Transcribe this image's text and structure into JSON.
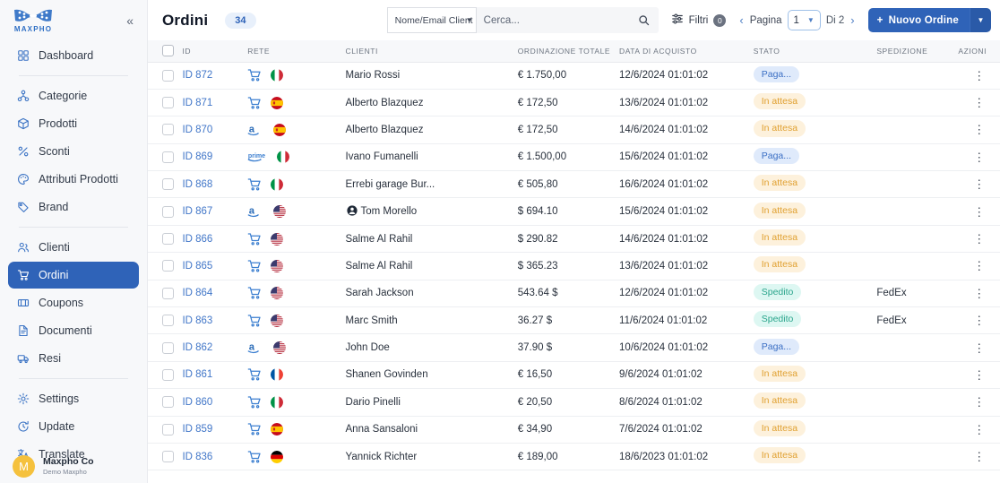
{
  "sidebar": {
    "logo_text": "MAXPHO",
    "collapse_icon": "chevron-double-left-icon",
    "groups": [
      {
        "items": [
          {
            "label": "Dashboard",
            "icon": "dashboard-icon",
            "active": false
          }
        ]
      },
      {
        "items": [
          {
            "label": "Categorie",
            "icon": "categories-icon",
            "active": false
          },
          {
            "label": "Prodotti",
            "icon": "box-icon",
            "active": false
          },
          {
            "label": "Sconti",
            "icon": "percent-icon",
            "active": false
          },
          {
            "label": "Attributi Prodotti",
            "icon": "palette-icon",
            "active": false
          },
          {
            "label": "Brand",
            "icon": "tag-icon",
            "active": false
          }
        ]
      },
      {
        "items": [
          {
            "label": "Clienti",
            "icon": "users-icon",
            "active": false
          },
          {
            "label": "Ordini",
            "icon": "cart-icon",
            "active": true
          },
          {
            "label": "Coupons",
            "icon": "ticket-icon",
            "active": false
          },
          {
            "label": "Documenti",
            "icon": "document-icon",
            "active": false
          },
          {
            "label": "Resi",
            "icon": "truck-icon",
            "active": false
          }
        ]
      },
      {
        "items": [
          {
            "label": "Settings",
            "icon": "gear-icon",
            "active": false
          },
          {
            "label": "Update",
            "icon": "refresh-clock-icon",
            "active": false
          },
          {
            "label": "Translate",
            "icon": "translate-icon",
            "active": false
          }
        ]
      }
    ],
    "account": {
      "initial": "M",
      "name": "Maxpho Co",
      "subtitle": "Demo Maxpho"
    }
  },
  "header": {
    "title": "Ordini",
    "count": "34",
    "search": {
      "field_selector": "Nome/Email Client",
      "placeholder": "Cerca...",
      "value": "",
      "search_icon": "search-icon",
      "caret_icon": "caret-down-icon"
    },
    "filters": {
      "label": "Filtri",
      "count": "0",
      "icon": "filter-sliders-icon"
    },
    "pagination": {
      "prev_icon": "chevron-left-icon",
      "label": "Pagina",
      "current": "1",
      "caret_icon": "caret-down-icon",
      "of_label": "Di 2",
      "next_icon": "chevron-right-icon"
    },
    "new_order": {
      "label": "Nuovo Ordine",
      "plus_icon": "plus-icon",
      "caret_icon": "caret-down-icon"
    },
    "accent_color": "#2f63b8"
  },
  "table": {
    "columns": [
      "ID",
      "RETE",
      "CLIENTI",
      "ORDINAZIONE TOTALE",
      "DATA DI ACQUISTO",
      "STATO",
      "SPEDIZIONE",
      "AZIONI"
    ],
    "rows": [
      {
        "id": "ID 872",
        "network": "cart-icon",
        "flag": "it",
        "client": "Mario Rossi",
        "client_icon": "",
        "total": "€ 1.750,00",
        "date": "12/6/2024 01:01:02",
        "status": "Paga...",
        "status_kind": "paid",
        "shipping": ""
      },
      {
        "id": "ID 871",
        "network": "cart-icon",
        "flag": "es",
        "client": "Alberto Blazquez",
        "client_icon": "",
        "total": "€ 172,50",
        "date": "13/6/2024 01:01:02",
        "status": "In attesa",
        "status_kind": "pending",
        "shipping": ""
      },
      {
        "id": "ID 870",
        "network": "amazon-icon",
        "flag": "es",
        "client": "Alberto Blazquez",
        "client_icon": "",
        "total": "€ 172,50",
        "date": "14/6/2024 01:01:02",
        "status": "In attesa",
        "status_kind": "pending",
        "shipping": ""
      },
      {
        "id": "ID 869",
        "network": "prime-icon",
        "flag": "it",
        "client": "Ivano Fumanelli",
        "client_icon": "",
        "total": "€ 1.500,00",
        "date": "15/6/2024 01:01:02",
        "status": "Paga...",
        "status_kind": "paid",
        "shipping": ""
      },
      {
        "id": "ID 868",
        "network": "cart-icon",
        "flag": "it",
        "client": "Errebi garage Bur...",
        "client_icon": "",
        "total": "€ 505,80",
        "date": "16/6/2024 01:01:02",
        "status": "In attesa",
        "status_kind": "pending",
        "shipping": ""
      },
      {
        "id": "ID 867",
        "network": "amazon-icon",
        "flag": "us",
        "client": "Tom Morello",
        "client_icon": "person-icon",
        "total": "$ 694.10",
        "date": "15/6/2024 01:01:02",
        "status": "In attesa",
        "status_kind": "pending",
        "shipping": ""
      },
      {
        "id": "ID 866",
        "network": "cart-icon",
        "flag": "us",
        "client": "Salme Al Rahil",
        "client_icon": "",
        "total": "$ 290.82",
        "date": "14/6/2024 01:01:02",
        "status": "In attesa",
        "status_kind": "pending",
        "shipping": ""
      },
      {
        "id": "ID 865",
        "network": "cart-icon",
        "flag": "us",
        "client": "Salme Al Rahil",
        "client_icon": "",
        "total": "$ 365.23",
        "date": "13/6/2024 01:01:02",
        "status": "In attesa",
        "status_kind": "pending",
        "shipping": ""
      },
      {
        "id": "ID 864",
        "network": "cart-icon",
        "flag": "us",
        "client": "Sarah Jackson",
        "client_icon": "",
        "total": "543.64 $",
        "date": "12/6/2024 01:01:02",
        "status": "Spedito",
        "status_kind": "shipped",
        "shipping": "FedEx"
      },
      {
        "id": "ID 863",
        "network": "cart-icon",
        "flag": "us",
        "client": "Marc Smith",
        "client_icon": "",
        "total": "36.27 $",
        "date": "11/6/2024 01:01:02",
        "status": "Spedito",
        "status_kind": "shipped",
        "shipping": "FedEx"
      },
      {
        "id": "ID 862",
        "network": "amazon-icon",
        "flag": "us",
        "client": "John Doe",
        "client_icon": "",
        "total": "37.90 $",
        "date": "10/6/2024 01:01:02",
        "status": "Paga...",
        "status_kind": "paid",
        "shipping": ""
      },
      {
        "id": "ID 861",
        "network": "cart-icon",
        "flag": "fr",
        "client": "Shanen Govinden",
        "client_icon": "",
        "total": "€ 16,50",
        "date": "9/6/2024 01:01:02",
        "status": "In attesa",
        "status_kind": "pending",
        "shipping": ""
      },
      {
        "id": "ID 860",
        "network": "cart-icon",
        "flag": "it",
        "client": "Dario Pinelli",
        "client_icon": "",
        "total": "€ 20,50",
        "date": "8/6/2024 01:01:02",
        "status": "In attesa",
        "status_kind": "pending",
        "shipping": ""
      },
      {
        "id": "ID 859",
        "network": "cart-icon",
        "flag": "es",
        "client": "Anna Sansaloni",
        "client_icon": "",
        "total": "€ 34,90",
        "date": "7/6/2024 01:01:02",
        "status": "In attesa",
        "status_kind": "pending",
        "shipping": ""
      },
      {
        "id": "ID 836",
        "network": "cart-icon",
        "flag": "de",
        "client": "Yannick Richter",
        "client_icon": "",
        "total": "€ 189,00",
        "date": "18/6/2023 01:01:02",
        "status": "In attesa",
        "status_kind": "pending",
        "shipping": ""
      }
    ],
    "row_menu_icon": "kebab-menu-icon"
  }
}
